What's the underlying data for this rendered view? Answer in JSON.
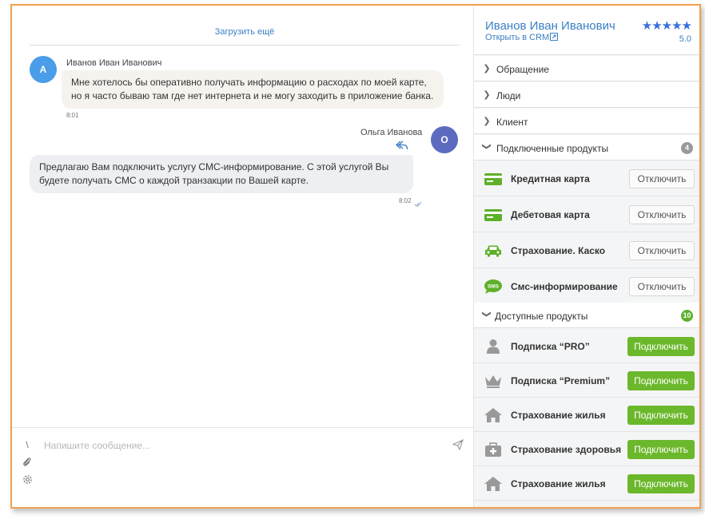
{
  "chat": {
    "load_more": "Загрузить ещё",
    "messages": [
      {
        "avatar": "А",
        "sender": "Иванов Иван Иванович",
        "text": "Мне хотелось бы оперативно получать информацию о расходах по моей карте, но я часто бываю там где нет интернета и не могу заходить в приложение банка.",
        "time": "8:01"
      },
      {
        "avatar": "О",
        "sender": "Ольга Иванова",
        "text": "Предлагаю Вам подключить услугу СМС-информирование. С этой услугой Вы будете получать СМС о каждой транзакции по Вашей карте.",
        "time": "8:02"
      }
    ],
    "composer_placeholder": "Напишите сообщение...",
    "tool_slash": "\\"
  },
  "client": {
    "name": "Иванов Иван Иванович",
    "crm_link": "Открыть в CRM",
    "stars": "★★★★★",
    "rating": "5.0"
  },
  "sections": {
    "appeal": "Обращение",
    "people": "Люди",
    "client": "Клиент",
    "connected": {
      "label": "Подключенные продукты",
      "count": "4"
    },
    "available": {
      "label": "Доступные продукты",
      "count": "10"
    }
  },
  "connected_products": [
    {
      "name": "Кредитная карта",
      "icon": "credit-card-icon",
      "button": "Отключить"
    },
    {
      "name": "Дебетовая карта",
      "icon": "debit-card-icon",
      "button": "Отключить"
    },
    {
      "name": "Страхование. Каско",
      "icon": "car-icon",
      "button": "Отключить"
    },
    {
      "name": "Смс-информирование",
      "icon": "sms-icon",
      "button": "Отключить"
    }
  ],
  "available_products": [
    {
      "name": "Подписка “PRO”",
      "icon": "person-icon",
      "button": "Подключить"
    },
    {
      "name": "Подписка “Premium”",
      "icon": "crown-icon",
      "button": "Подключить"
    },
    {
      "name": "Страхование жилья",
      "icon": "house-icon",
      "button": "Подключить"
    },
    {
      "name": "Страхование здоровья",
      "icon": "medkit-icon",
      "button": "Подключить"
    },
    {
      "name": "Страхование жилья",
      "icon": "house-icon",
      "button": "Подключить"
    }
  ],
  "colors": {
    "accent_blue": "#3a7fc4",
    "client_avatar": "#4a9de8",
    "operator_avatar": "#5c6bc0",
    "connect_green": "#6cb82c",
    "icon_green": "#5eb02a",
    "icon_gray": "#999999",
    "frame_orange": "#f0a050"
  }
}
